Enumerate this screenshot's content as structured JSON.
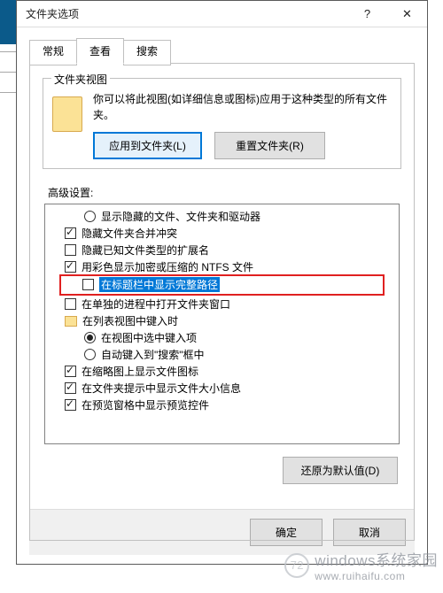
{
  "title": "文件夹选项",
  "tabs": {
    "general": "常规",
    "view": "查看",
    "search": "搜索"
  },
  "groupbox": {
    "label": "文件夹视图",
    "desc": "你可以将此视图(如详细信息或图标)应用于这种类型的所有文件夹。",
    "apply_btn": "应用到文件夹(L)",
    "reset_btn": "重置文件夹(R)"
  },
  "settings_label": "高级设置:",
  "opts": [
    {
      "type": "radio",
      "checked": false,
      "indent": 2,
      "label": "显示隐藏的文件、文件夹和驱动器"
    },
    {
      "type": "check",
      "checked": true,
      "indent": 1,
      "label": "隐藏文件夹合并冲突"
    },
    {
      "type": "check",
      "checked": false,
      "indent": 1,
      "label": "隐藏已知文件类型的扩展名"
    },
    {
      "type": "check",
      "checked": true,
      "indent": 1,
      "label": "用彩色显示加密或压缩的 NTFS 文件"
    },
    {
      "type": "check",
      "checked": false,
      "indent": 1,
      "highlight": true,
      "selected": true,
      "label": "在标题栏中显示完整路径"
    },
    {
      "type": "check",
      "checked": false,
      "indent": 1,
      "label": "在单独的进程中打开文件夹窗口"
    },
    {
      "type": "folder",
      "indent": 1,
      "label": "在列表视图中键入时"
    },
    {
      "type": "radio",
      "checked": true,
      "indent": 2,
      "label": "在视图中选中键入项"
    },
    {
      "type": "radio",
      "checked": false,
      "indent": 2,
      "label": "自动键入到\"搜索\"框中"
    },
    {
      "type": "check",
      "checked": true,
      "indent": 1,
      "label": "在缩略图上显示文件图标"
    },
    {
      "type": "check",
      "checked": true,
      "indent": 1,
      "label": "在文件夹提示中显示文件大小信息"
    },
    {
      "type": "check",
      "checked": true,
      "indent": 1,
      "label": "在预览窗格中显示预览控件"
    }
  ],
  "restore_btn": "还原为默认值(D)",
  "ok_btn": "确定",
  "cancel_btn": "取消",
  "watermark": {
    "line1": "windows系统家园",
    "line2": "www.ruihaifu.com"
  }
}
